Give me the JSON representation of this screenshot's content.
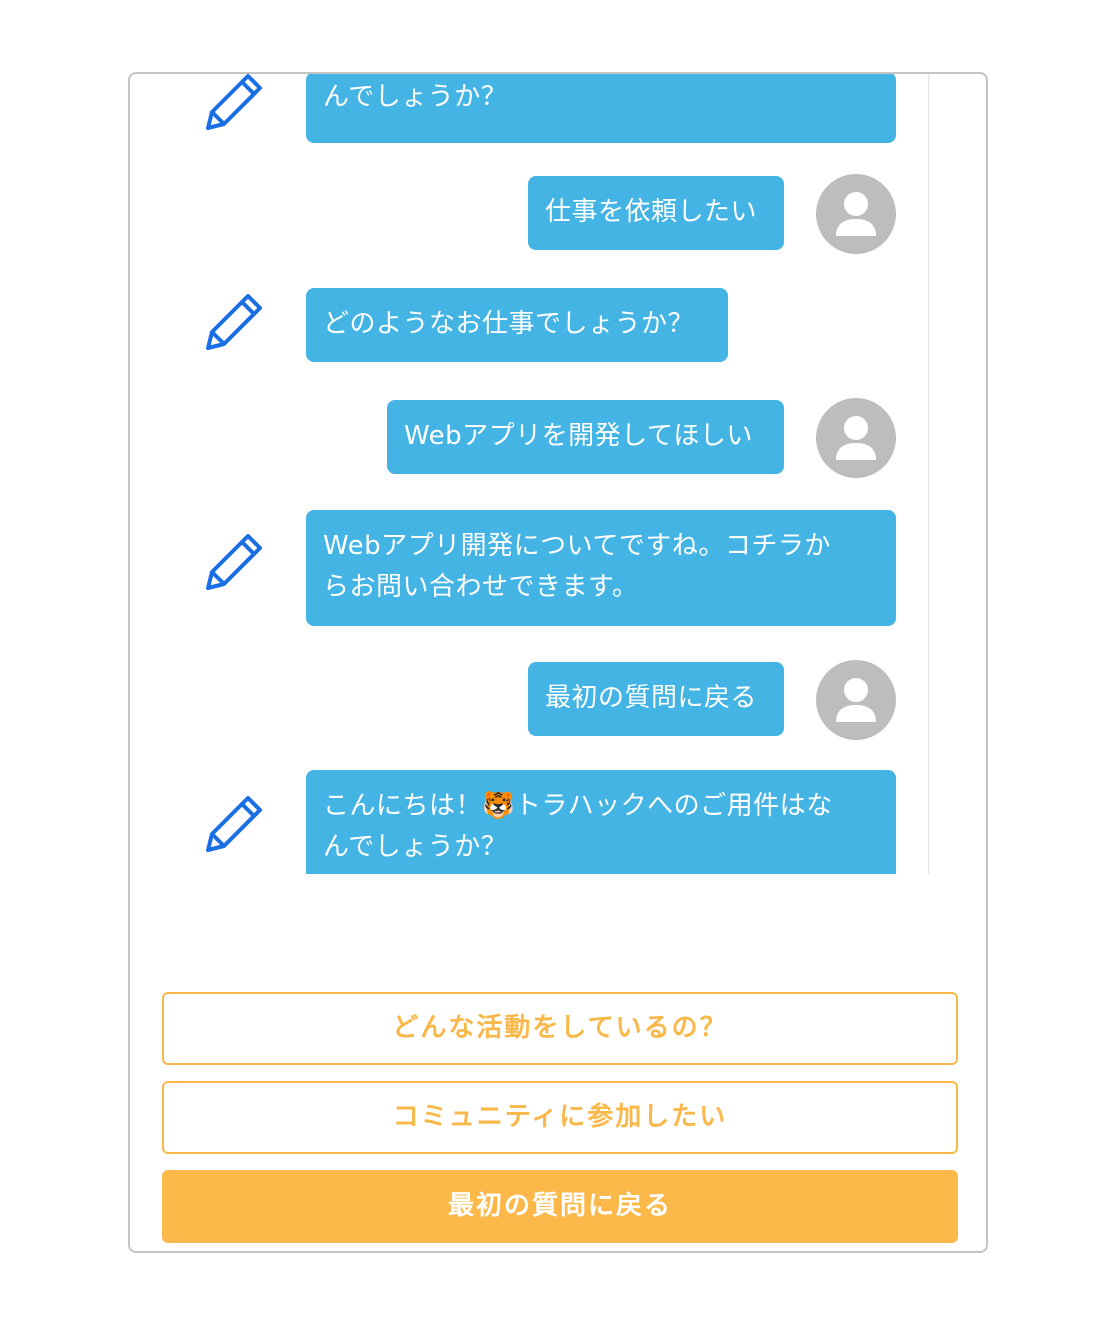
{
  "messages": [
    {
      "role": "bot",
      "lines": [
        "んでしょうか？"
      ]
    },
    {
      "role": "user",
      "text": "仕事を依頼したい"
    },
    {
      "role": "bot",
      "lines": [
        "どのようなお仕事でしょうか？"
      ]
    },
    {
      "role": "user",
      "text": "Webアプリを開発してほしい"
    },
    {
      "role": "bot",
      "lines": [
        "Webアプリ開発についてですね。コチラか",
        "らお問い合わせできます。"
      ]
    },
    {
      "role": "user",
      "text": "最初の質問に戻る"
    },
    {
      "role": "bot",
      "lines": [
        "こんにちは！🐯トラハックへのご用件はな",
        "んでしょうか？"
      ]
    }
  ],
  "choices": {
    "option1": "どんな活動をしているの？",
    "option2": "コミュニティに参加したい",
    "option3": "最初の質問に戻る"
  },
  "icons": {
    "bot": "pencil-icon",
    "user": "user-avatar-icon"
  },
  "colors": {
    "bubble": "#43b4e4",
    "accent": "#fdb84a",
    "pencil": "#1a6fe6",
    "avatar": "#bdbdbd"
  }
}
